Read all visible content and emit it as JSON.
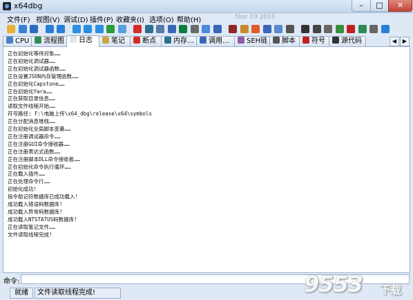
{
  "window": {
    "title": "x64dbg",
    "min": "–",
    "max": "□",
    "close": "✕"
  },
  "menu": {
    "items": [
      "文件(F)",
      "视图(V)",
      "调试(D)",
      "插件(P)",
      "收藏夹(I)",
      "选项(O)",
      "帮助(H)"
    ],
    "date": "Nov 19 2016"
  },
  "toolbar": {
    "icons": [
      "open-icon",
      "restart-icon",
      "close-icon",
      "run-icon",
      "pause-icon",
      "step-into-icon",
      "step-over-icon",
      "step-out-icon",
      "run-to-user-icon",
      "run-to-selection-icon",
      "breakpoint-icon",
      "memory-icon",
      "modules-icon",
      "threads-icon",
      "patch-icon",
      "comments-icon",
      "labels-icon",
      "bookmarks-icon",
      "functions-icon",
      "script-icon",
      "highlight-icon",
      "trace-icon",
      "find-icon",
      "calculator-icon",
      "font-icon",
      "text-size-icon",
      "settings-icon",
      "plugins-icon",
      "cpu-icon",
      "bug-icon",
      "favorites-icon",
      "about-icon"
    ],
    "colors": [
      "#e9b13a",
      "#3b7fd1",
      "#2b6dbf",
      "#2a7fd8",
      "#2a7fd8",
      "#2b8fe0",
      "#2b8fe0",
      "#2b8fe0",
      "#2d9a3b",
      "#5aa0e0",
      "#d42b2b",
      "#2c6f8f",
      "#5b79a6",
      "#3a66b6",
      "#0a7f3a",
      "#6b6b6b",
      "#4a89dc",
      "#3a66b6",
      "#8e2626",
      "#c98a2c",
      "#e05a2a",
      "#3a66b6",
      "#5a8ad0",
      "#555555",
      "#333333",
      "#444444",
      "#666666",
      "#3a8f3a",
      "#c02020",
      "#2e8b57",
      "#666666",
      "#2a7fd8"
    ]
  },
  "tabs": [
    {
      "label": "CPU",
      "icon": "cpu-tab-icon",
      "color": "#4a7fc1",
      "active": false
    },
    {
      "label": "流程图",
      "icon": "graph-tab-icon",
      "color": "#2e8b57",
      "active": false
    },
    {
      "label": "日志",
      "icon": "log-tab-icon",
      "color": "#e0e6ee",
      "active": true
    },
    {
      "label": "笔记",
      "icon": "notes-tab-icon",
      "color": "#c9a64a",
      "active": false
    },
    {
      "label": "断点",
      "icon": "breakpoints-tab-icon",
      "color": "#d42b2b",
      "active": false
    },
    {
      "label": "内存…",
      "icon": "memory-tab-icon",
      "color": "#2c6f8f",
      "active": false
    },
    {
      "label": "调用…",
      "icon": "callstack-tab-icon",
      "color": "#3a66b6",
      "active": false
    },
    {
      "label": "SEH链",
      "icon": "seh-tab-icon",
      "color": "#8e5aa6",
      "active": false
    },
    {
      "label": "脚本",
      "icon": "script-tab-icon",
      "color": "#555555",
      "active": false
    },
    {
      "label": "符号",
      "icon": "symbols-tab-icon",
      "color": "#c02020",
      "active": false
    },
    {
      "label": "源代码",
      "icon": "source-tab-icon",
      "color": "#333333",
      "active": false
    }
  ],
  "log": {
    "lines": [
      "正在初始化等待对象……",
      "正在初始化调试器……",
      "正在初始化调试器函数……",
      "正在设置JSON内存管理函数……",
      "正在初始化Capstone……",
      "正在初始化Yara……",
      "正在获取目录信息……",
      "读取文件线程开始……",
      "符号路径:  F:\\电脑上传\\x64_dbg\\release\\x64\\symbols",
      "正在分配消息堆栈……",
      "正在初始化全局脚本变量……",
      "正在注册调试器命令……",
      "正在注册GUI命令接收器……",
      "正在注册表达式函数……",
      "正在注册脚本DLL命令接收者……",
      "正在初始化命令执行循环……",
      "正在载入插件……",
      "正在处理命令行……",
      "初始化成功!",
      "指令助记符数据库已成功载入!",
      "成功载入错误码数据库!",
      "成功载入异常码数据库!",
      "成功载入NTSTATUS码数据库!",
      "正在读取笔记文件……",
      "文件读取线程完成!"
    ]
  },
  "command": {
    "label": "命令:",
    "value": ""
  },
  "status": {
    "state": "就绪",
    "message": "文件读取线程完成!"
  },
  "watermark": {
    "text": "9553",
    "suffix": "下载"
  }
}
